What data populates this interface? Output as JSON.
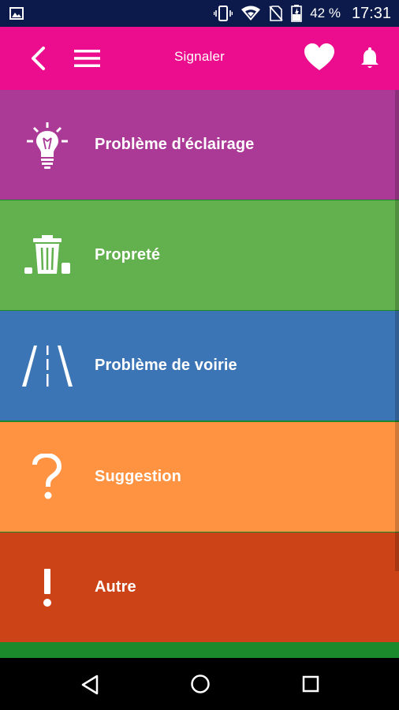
{
  "status_bar": {
    "battery_percent": "42 %",
    "time": "17:31"
  },
  "app_bar": {
    "title": "Signaler",
    "background": "#ec0d8e"
  },
  "items": [
    {
      "label": "Problème d'éclairage",
      "color": "#ab3a97",
      "icon": "lightbulb-icon"
    },
    {
      "label": "Propreté",
      "color": "#62b04e",
      "icon": "trash-bin-icon"
    },
    {
      "label": "Problème de voirie",
      "color": "#3c75b5",
      "icon": "road-icon"
    },
    {
      "label": "Suggestion",
      "color": "#ff9342",
      "icon": "question-mark-icon"
    },
    {
      "label": "Autre",
      "color": "#cc4317",
      "icon": "exclamation-icon"
    }
  ]
}
